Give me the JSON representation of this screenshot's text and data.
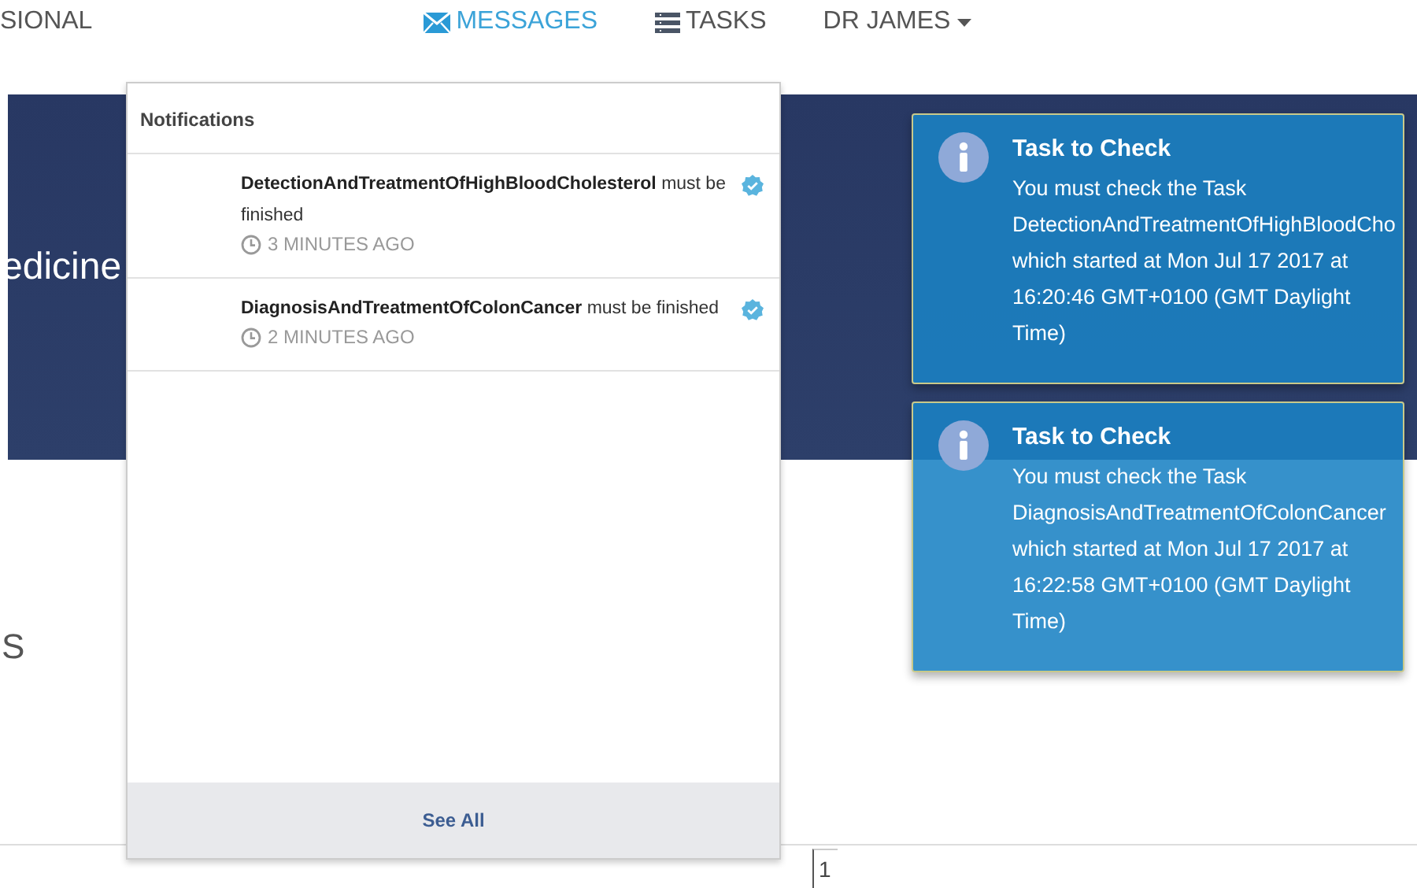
{
  "brand": "SIONAL",
  "nav": [
    {
      "label": "MESSAGES",
      "kind": "mail",
      "selected": true
    },
    {
      "label": "TASKS",
      "kind": "list",
      "selected": false
    },
    {
      "label": "DR JAMES",
      "kind": "menu",
      "selected": false
    }
  ],
  "banner": {
    "title": "edicine"
  },
  "section_heading": "S",
  "pager": "1",
  "notifications": {
    "title": "Notifications",
    "items": [
      {
        "task": "DetectionAndTreatmentOfHighBloodCholesterol",
        "text": "must be finished",
        "time": "3 MINUTES AGO",
        "verified": true
      },
      {
        "task": "DiagnosisAndTreatmentOfColonCancer",
        "text": "must be finished",
        "time": "2 MINUTES AGO",
        "verified": true
      }
    ],
    "footer": "See All"
  },
  "toasts": [
    {
      "title": "Task to Check",
      "body": "You must check the Task DetectionAndTreatmentOfHighBloodCho which started at Mon Jul 17 2017 at 16:20:46 GMT+0100 (GMT Daylight Time)"
    },
    {
      "title": "Task to Check",
      "body": "You must check the Task DiagnosisAndTreatmentOfColonCancer which started at Mon Jul 17 2017 at 16:22:58 GMT+0100 (GMT Daylight Time)"
    }
  ]
}
